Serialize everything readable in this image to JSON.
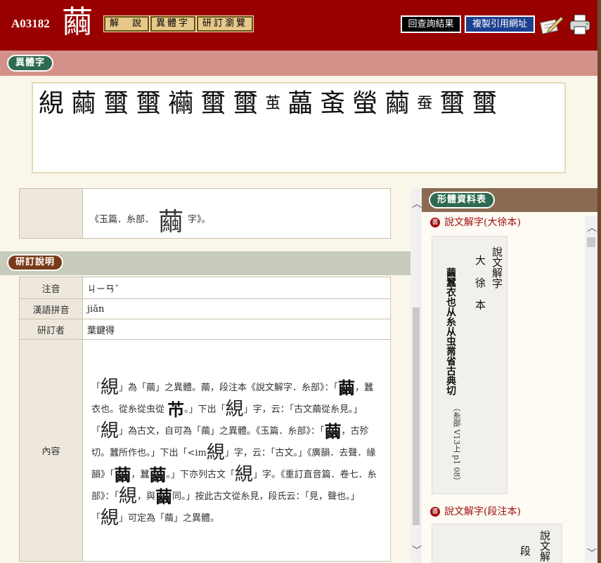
{
  "header": {
    "code": "A03182",
    "char": "繭",
    "tabs": [
      "解　說",
      "異體字",
      "研訂瀏覽"
    ],
    "back_label": "回查詢結果",
    "copy_label": "複製引用網址"
  },
  "variants": {
    "label": "異體字",
    "glyphs": [
      "絸",
      "繭",
      "蠒",
      "蠒",
      "襺",
      "蠒",
      "蠒",
      "茧",
      "藟",
      "蚉",
      "螢",
      "繭",
      "蚕",
      "蠒",
      "蠒"
    ]
  },
  "yupian": {
    "text_before": "《玉篇．糸部．",
    "glyph": "繭",
    "text_after": "字》。"
  },
  "review": {
    "label": "研訂說明",
    "rows": [
      {
        "h": "注音",
        "v": "ㄐㄧㄢˇ"
      },
      {
        "h": "漢語拼音",
        "v": "jiǎn"
      },
      {
        "h": "研訂者",
        "v": "葉鍵得"
      }
    ],
    "content_label": "內容",
    "content": [
      {
        "t": "「"
      },
      {
        "g": "絸"
      },
      {
        "t": "」為「繭」之異體。繭，段注本《說文解字．糸部》：「"
      },
      {
        "gb": "繭"
      },
      {
        "t": "，蠶衣也。從糸從虫從 "
      },
      {
        "gb": "芇"
      },
      {
        "t": "。」下出「"
      },
      {
        "g": "絸"
      },
      {
        "t": "」字，云：「古文繭從糸見。」「"
      },
      {
        "g": "絸"
      },
      {
        "t": "」為古文，自可為「繭」之異體。《玉篇．糸部》：「"
      },
      {
        "gb": "繭"
      },
      {
        "t": "，古殄切。蠶所作也。」下出「<im"
      },
      {
        "g": "絸"
      },
      {
        "t": "」字，云：「古文。」《廣韻．去聲．緣韻》「"
      },
      {
        "gb": "繭"
      },
      {
        "t": "，蠶"
      },
      {
        "gb": "繭"
      },
      {
        "t": "。」下亦列古文「"
      },
      {
        "g": "絸"
      },
      {
        "t": "」字。《重訂直音篇．卷七．糸部》：「"
      },
      {
        "g": "絸"
      },
      {
        "t": "，與"
      },
      {
        "gb": "繭"
      },
      {
        "t": "同。」按此古文從糸見，段氏云：「見，聲也。」「"
      },
      {
        "g": "絸"
      },
      {
        "t": "」可定為「繭」之異體。"
      }
    ]
  },
  "right": {
    "label": "形體資料表",
    "sources": [
      "說文解字(大徐本)",
      "說文解字(段注本)"
    ],
    "scan1": {
      "col1": "說文解字",
      "col2": "大 徐 本",
      "main": "繭蠶衣也从糸从虫黹省古典切",
      "note": "（糸部 V13上 p1 08）"
    },
    "scan2": {
      "col1": "說文解",
      "col2": "段"
    }
  },
  "colors": {
    "header": "#990000",
    "band": "#d4918a",
    "pill_green": "#2e6a4f",
    "pill_brown": "#7a3b1a"
  }
}
